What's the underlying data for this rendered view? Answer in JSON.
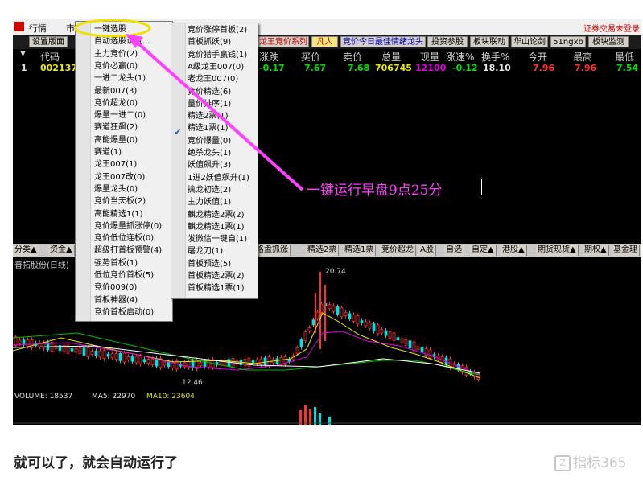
{
  "menubar": {
    "items": [
      "行情",
      "市"
    ],
    "warning": "证券交易未登录"
  },
  "tabs": [
    {
      "label": "设置版面",
      "style": ""
    },
    {
      "label": "龙王竞价系列",
      "style": "red"
    },
    {
      "label": "凡人",
      "style": "yel"
    },
    {
      "label": "竞价今日最佳情绪龙头",
      "style": "blue"
    },
    {
      "label": "投资参股",
      "style": ""
    },
    {
      "label": "板块联动",
      "style": ""
    },
    {
      "label": "华山论剑",
      "style": ""
    },
    {
      "label": "51ngxb",
      "style": ""
    },
    {
      "label": "板块监测",
      "style": ""
    }
  ],
  "quote": {
    "headers": [
      "代码",
      "涨跌",
      "买价",
      "卖价",
      "总量",
      "现量",
      "涨速%",
      "换手%",
      "今开",
      "最高",
      "最低"
    ],
    "row": {
      "index": "1",
      "code": "002137",
      "change": "-0.17",
      "bid": "7.67",
      "ask": "7.68",
      "volume": "706745",
      "current_volume": "12100",
      "speed": "-0.12",
      "turnover": "18.10",
      "open": "7.96",
      "high": "7.96",
      "low": "7.54"
    }
  },
  "menu1": {
    "items": [
      "一键选股",
      "自动选股设置...",
      "主力竞价(2)",
      "竞价必赢(0)",
      "一进二龙头(1)",
      "最新007(3)",
      "竞价超龙(0)",
      "爆量一进二(0)",
      "赛道狂飙(2)",
      "高能爆量(0)",
      "赛道(1)",
      "龙王007(1)",
      "龙王007改(0)",
      "爆量龙头(0)",
      "竞价当天板(2)",
      "高能精选1(1)",
      "竞价爆量抓涨停(0)",
      "竞价低位连板(0)",
      "超级打首板预警(4)",
      "强势首板(1)",
      "低位竞价首板(5)",
      "竞价009(0)",
      "首板神器(4)",
      "竞价首板启动(0)"
    ]
  },
  "menu2": {
    "items": [
      "竞价涨停首板(2)",
      "首板抓妖(9)",
      "竞价猎手赢钱(1)",
      "A级龙王007(0)",
      "老龙王007(0)",
      "竞价精选(6)",
      "量价排序(1)",
      "精选2票(1)",
      "精选1票(1)",
      "竞价爆量(0)",
      "绝杀龙头(1)",
      "妖值飙升(3)",
      "1进2妖值飙升(1)",
      "擒龙初选(2)",
      "主力妖值(1)",
      "麒龙精选2票(2)",
      "麒龙精选1票(1)",
      "发微信一键自(1)",
      "屠龙刀(1)",
      "首板预选(5)",
      "首板精选2票(2)",
      "首板精选1票(1)"
    ],
    "checked_index": 8
  },
  "chart_tabs": [
    {
      "label": "分类▲",
      "pos": "left"
    },
    {
      "label": "资金▲",
      "pos": "left"
    },
    {
      "label": "价格盘抓涨",
      "pos": "right"
    },
    {
      "label": "精选2票",
      "pos": "right"
    },
    {
      "label": "精选1票",
      "pos": "right"
    },
    {
      "label": "竞价超龙",
      "pos": "right"
    },
    {
      "label": "A股",
      "pos": "right"
    },
    {
      "label": "自选",
      "pos": "right"
    },
    {
      "label": "自定▲",
      "pos": "right"
    },
    {
      "label": "港股▲",
      "pos": "right"
    },
    {
      "label": "期货现货▲",
      "pos": "right"
    },
    {
      "label": "期权▲",
      "pos": "right"
    },
    {
      "label": "基金理",
      "pos": "right"
    }
  ],
  "chart": {
    "stock_name": "普拓股份(日线)",
    "high_label": "20.74",
    "low_label": "12.46",
    "volume_line": {
      "label": "VOLUME: 18537",
      "ma5": "MA5: 22970",
      "ma10": "MA10: 23604"
    }
  },
  "annotation": "一键运行早盘9点25分",
  "caption": "就可以了，就会自动运行了",
  "watermark": "指标365",
  "colors": {
    "annotation": "#ff40ff",
    "up": "#ff3030",
    "down": "#00e0e0",
    "ma_yellow": "#e8e800",
    "ma_green": "#00c000",
    "ma_magenta": "#e000e0"
  }
}
